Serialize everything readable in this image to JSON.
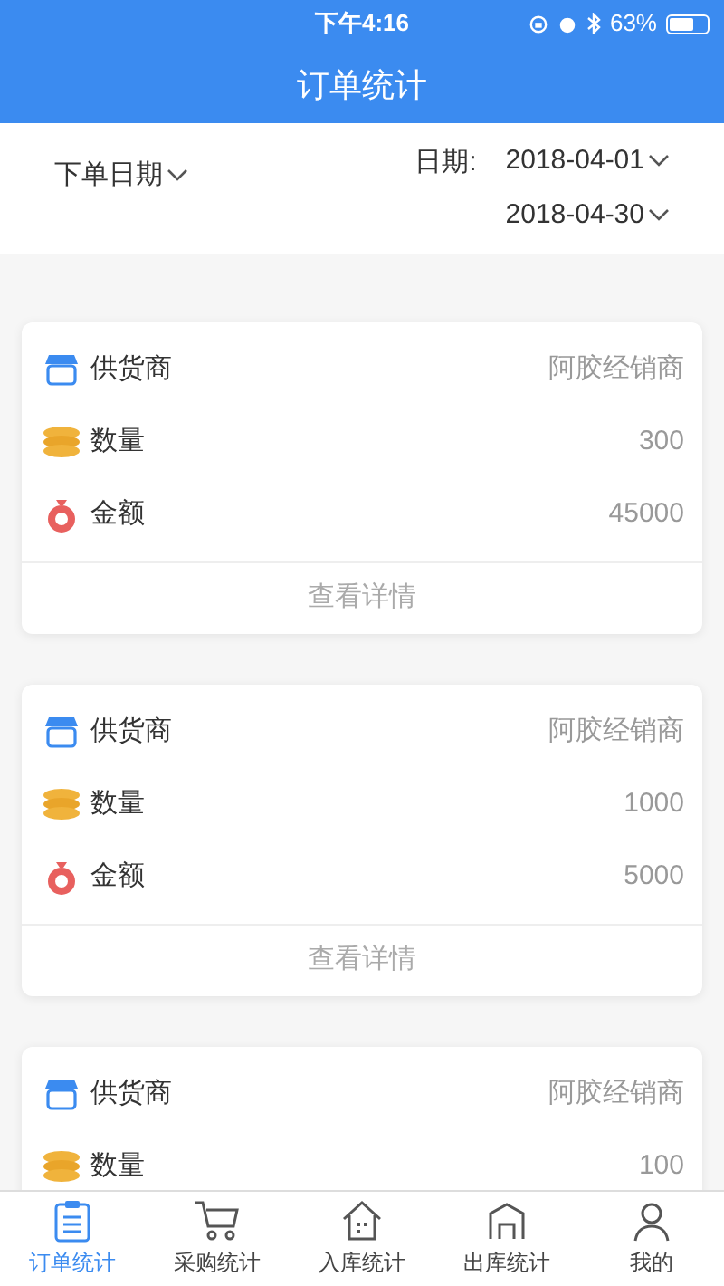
{
  "status_bar": {
    "time": "下午4:16",
    "battery": "63%"
  },
  "header": {
    "title": "订单统计"
  },
  "filter": {
    "sort": "下单日期",
    "date_label": "日期:",
    "start_date": "2018-04-01",
    "end_date": "2018-04-30"
  },
  "cards": [
    {
      "rows": [
        {
          "kind": "supplier",
          "label": "供货商",
          "value": "阿胶经销商"
        },
        {
          "kind": "quantity",
          "label": "数量",
          "value": "300"
        },
        {
          "kind": "amount",
          "label": "金额",
          "value": "45000"
        }
      ],
      "details": "查看详情"
    },
    {
      "rows": [
        {
          "kind": "supplier",
          "label": "供货商",
          "value": "阿胶经销商"
        },
        {
          "kind": "quantity",
          "label": "数量",
          "value": "1000"
        },
        {
          "kind": "amount",
          "label": "金额",
          "value": "5000"
        }
      ],
      "details": "查看详情"
    },
    {
      "rows": [
        {
          "kind": "supplier",
          "label": "供货商",
          "value": "阿胶经销商"
        },
        {
          "kind": "quantity",
          "label": "数量",
          "value": "100"
        }
      ]
    }
  ],
  "tab_bar": [
    {
      "kind": "orders",
      "label": "订单统计",
      "selected": true
    },
    {
      "kind": "cart",
      "label": "采购统计",
      "selected": false
    },
    {
      "kind": "inbound",
      "label": "入库统计",
      "selected": false
    },
    {
      "kind": "outbound",
      "label": "出库统计",
      "selected": false
    },
    {
      "kind": "me",
      "label": "我的",
      "selected": false
    }
  ]
}
